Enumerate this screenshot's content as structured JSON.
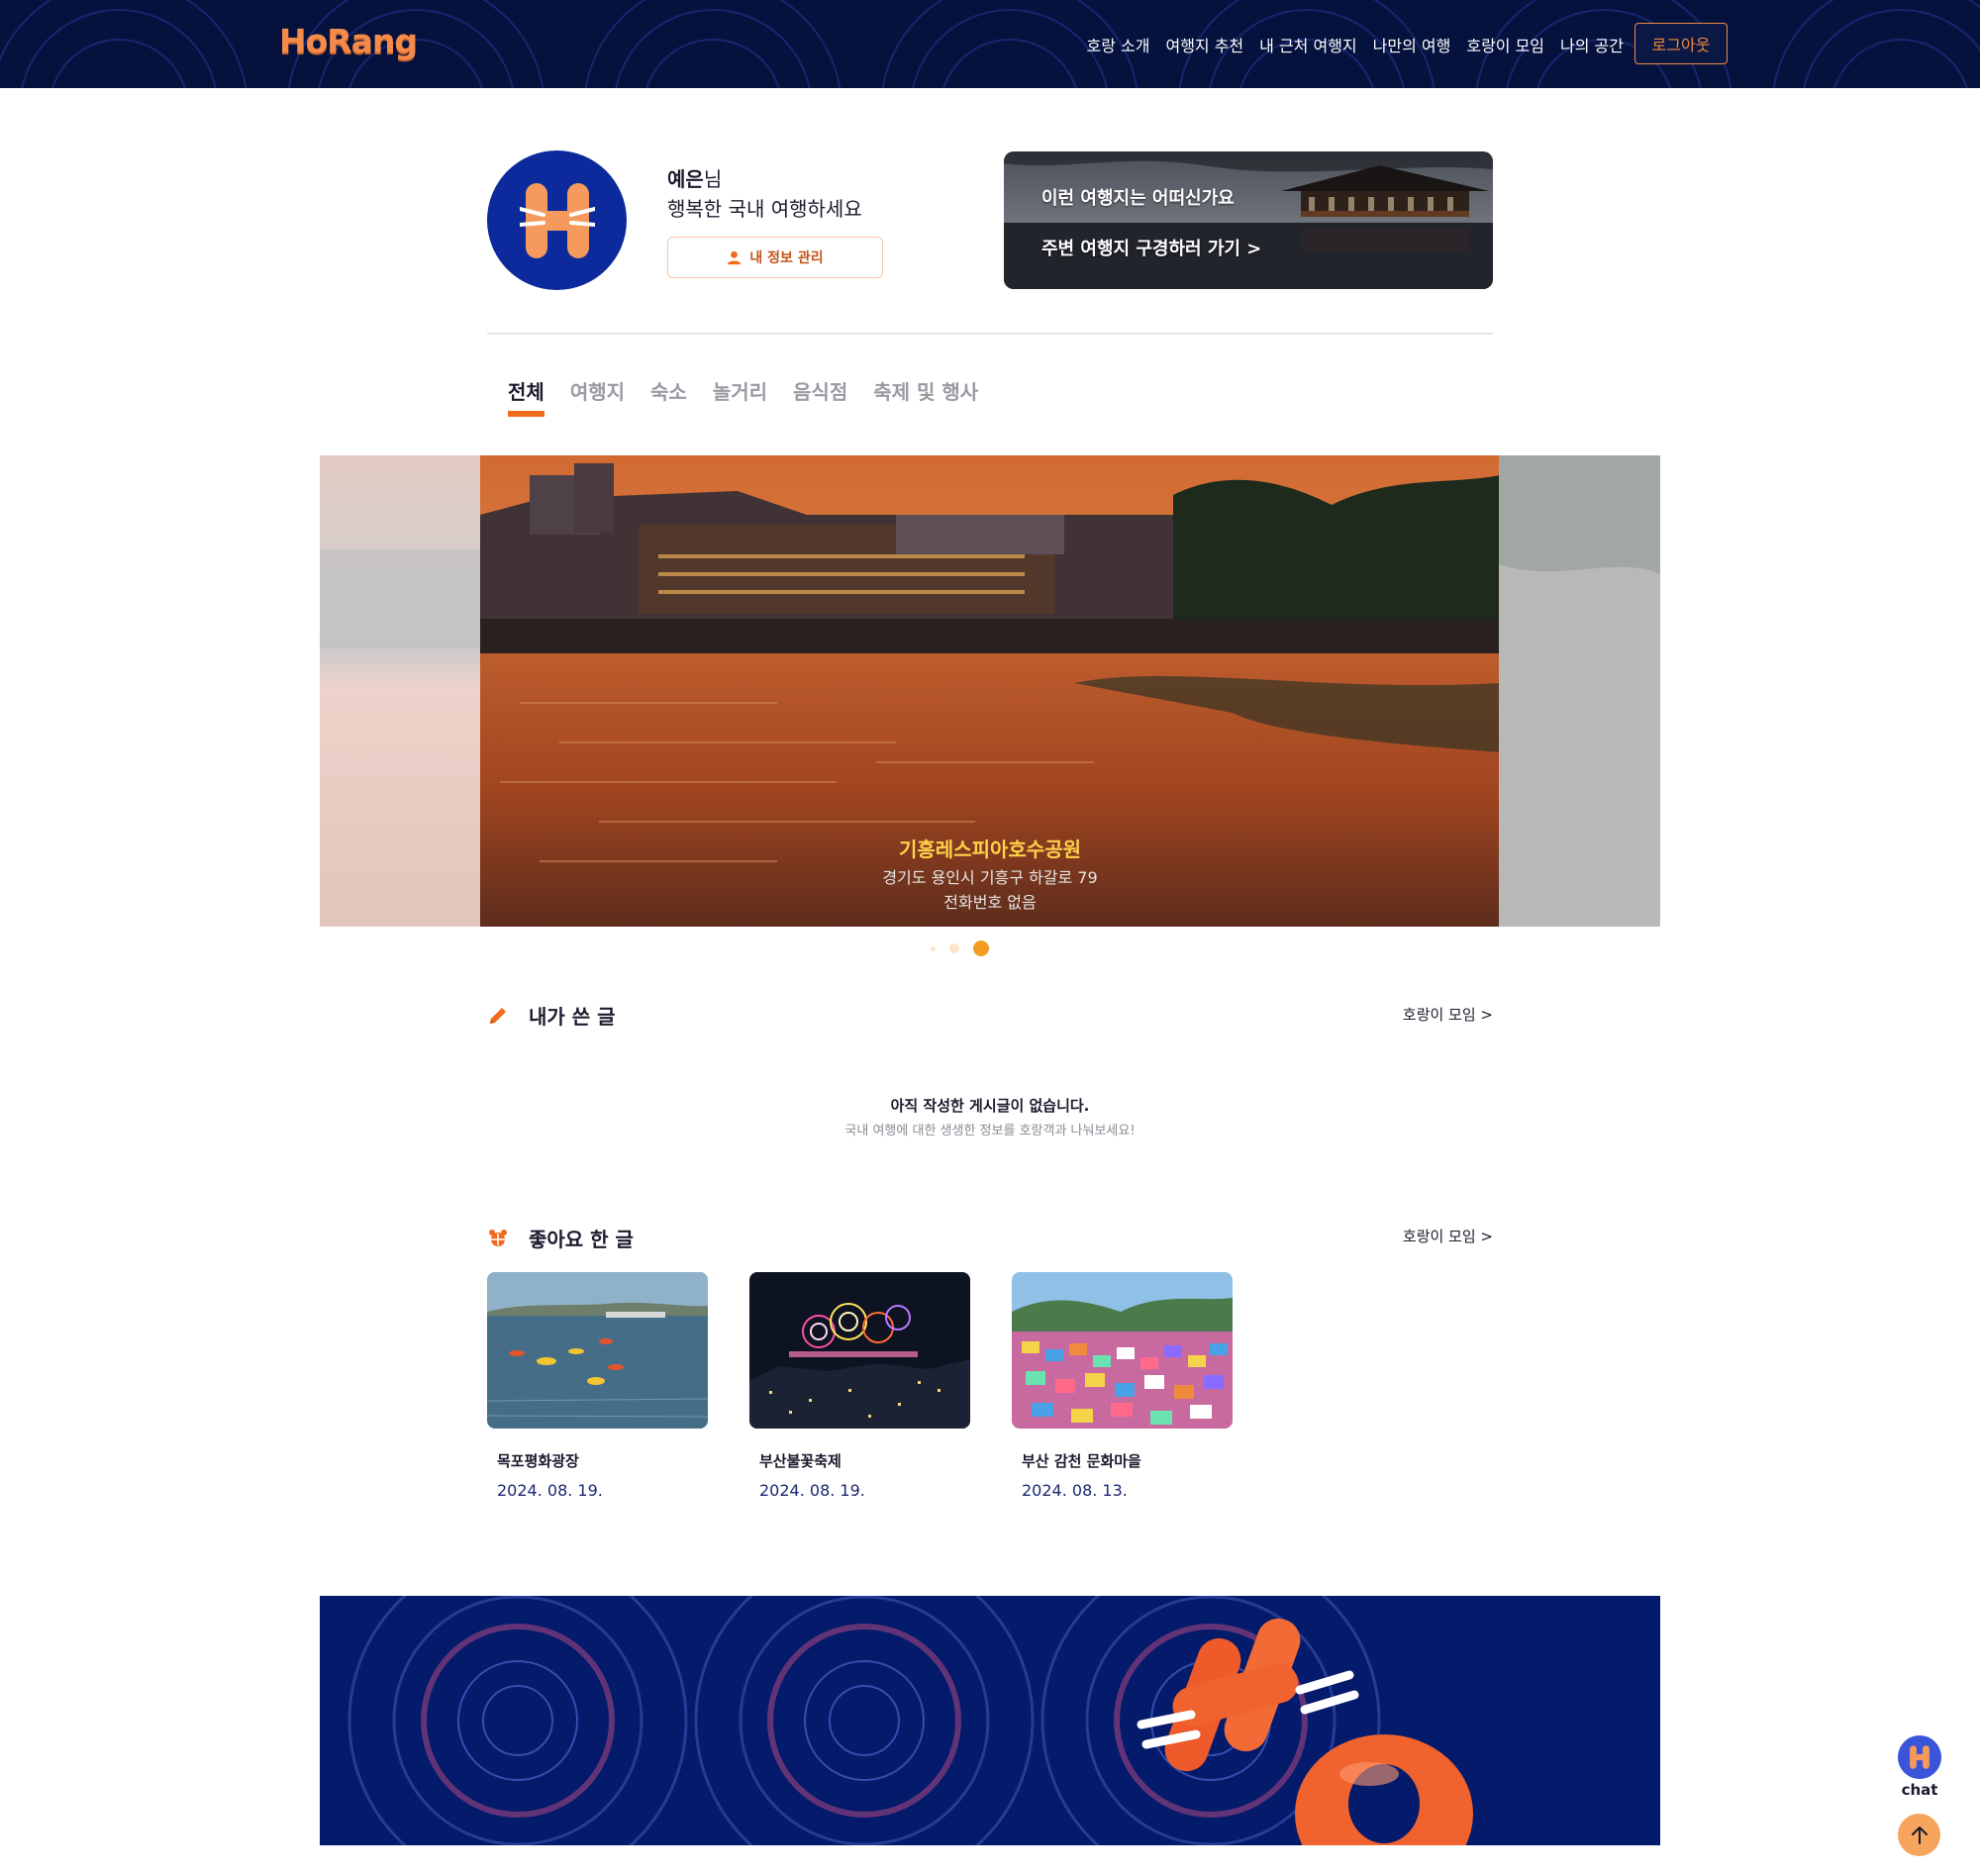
{
  "nav": {
    "logo": "HoRang",
    "items": [
      "호랑 소개",
      "여행지 추천",
      "내 근처 여행지",
      "나만의 여행",
      "호랑이 모임",
      "나의 공간"
    ],
    "logout": "로그아웃"
  },
  "profile": {
    "name": "예은",
    "name_suffix": "님",
    "greeting": "행복한 국내 여행하세요",
    "manage_button": "내 정보 관리"
  },
  "promo": {
    "line1": "이런 여행지는 어떠신가요",
    "line2": "주변 여행지 구경하러 가기 >"
  },
  "tabs": [
    "전체",
    "여행지",
    "숙소",
    "놀거리",
    "음식점",
    "축제 및 행사"
  ],
  "active_tab": 0,
  "carousel": {
    "title": "기흥레스피아호수공원",
    "address": "경기도 용인시 기흥구 하갈로 79",
    "phone": "전화번호 없음",
    "dots": 3,
    "active_dot": 2
  },
  "my_posts": {
    "title": "내가 쓴 글",
    "link": "호랑이 모임 >",
    "empty_title": "아직 작성한 게시글이 없습니다.",
    "empty_sub": "국내 여행에 대한 생생한 정보를 호랑객과 나눠보세요!"
  },
  "liked": {
    "title": "좋아요 한 글",
    "link": "호랑이 모임 >",
    "cards": [
      {
        "name": "목포평화광장",
        "date": "2024. 08. 19."
      },
      {
        "name": "부산불꽃축제",
        "date": "2024. 08. 19."
      },
      {
        "name": "부산 감천 문화마을",
        "date": "2024. 08. 13."
      }
    ]
  },
  "chat": {
    "label": "chat"
  },
  "colors": {
    "navy": "#06123e",
    "accent": "#f26a1b",
    "banner": "#041a6a",
    "date": "#1b2870"
  }
}
